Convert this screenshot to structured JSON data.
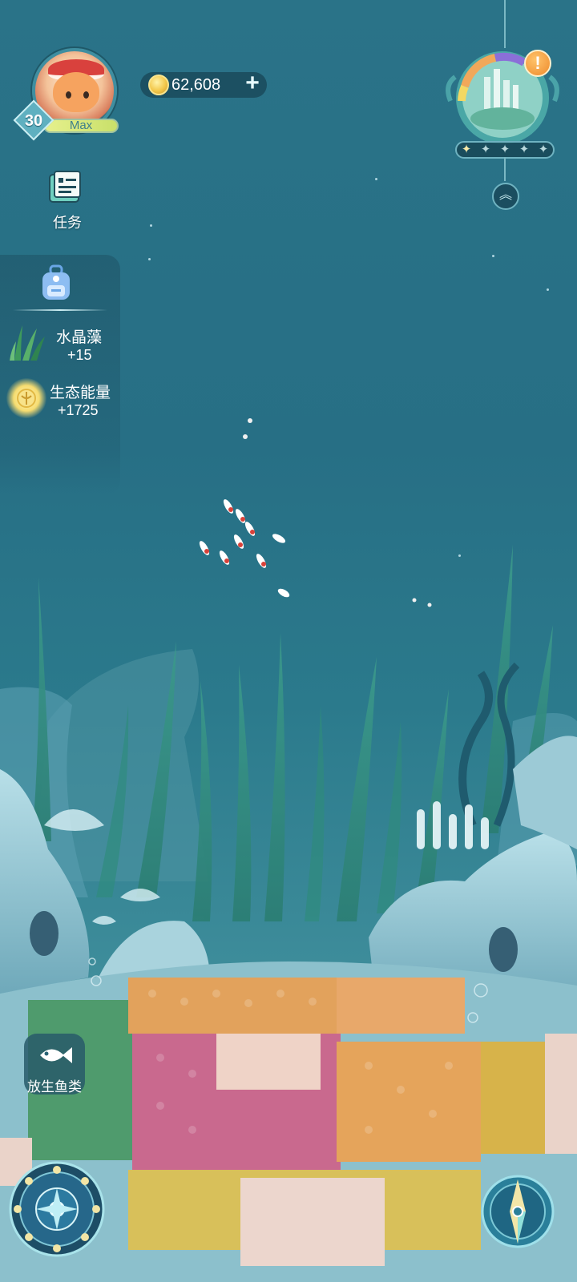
{
  "player": {
    "level": "30",
    "level_status": "Max"
  },
  "currency": {
    "coins": "62,608",
    "add_label": "+"
  },
  "tasks": {
    "label": "任务"
  },
  "rewards": {
    "items": [
      {
        "name": "水晶藻",
        "amount": "+15",
        "icon": "crystal-algae-icon"
      },
      {
        "name": "生态能量",
        "amount": "+1725",
        "icon": "eco-energy-icon"
      }
    ]
  },
  "ecosystem": {
    "alert": "!",
    "stars_total": 5,
    "stars_lit": 1,
    "star_glyph": "✦"
  },
  "collapse": {
    "glyph": "︽"
  },
  "release_fish": {
    "label": "放生鱼类"
  },
  "colors": {
    "water": "#2a7388",
    "panel": "#1e5264",
    "accent_gold": "#f3c84b",
    "level_bar": "#d9e87a",
    "alert": "#ee8a2c"
  }
}
